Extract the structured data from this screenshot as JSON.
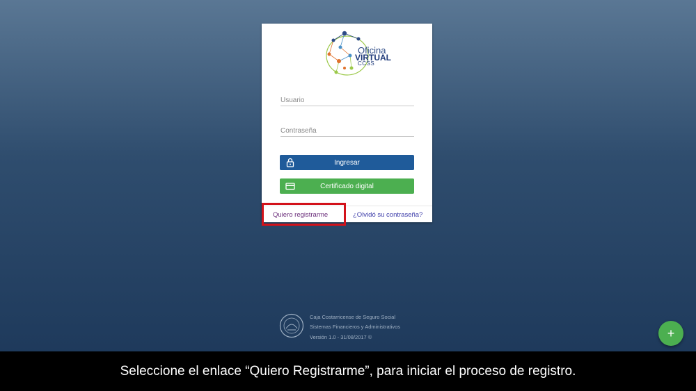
{
  "logo": {
    "line1": "Oficina",
    "line2": "VIRTUAL",
    "line3": "CCSS"
  },
  "login": {
    "user_placeholder": "Usuario",
    "pass_placeholder": "Contraseña",
    "ingresar_label": "Ingresar",
    "cert_label": "Certificado digital",
    "register_link": "Quiero registrarme",
    "forgot_link": "¿Olvidó su contraseña?"
  },
  "footer": {
    "line1": "Caja Costarricense de Seguro Social",
    "line2": "Sistemas Financieros y Administrativos",
    "line3": "Versión 1.0 - 31/08/2017 ©"
  },
  "fab": {
    "label": "+"
  },
  "caption": {
    "text": "Seleccione el enlace “Quiero Registrarme”, para iniciar el proceso de registro."
  },
  "colors": {
    "primary": "#1f5b9a",
    "success": "#4caf50",
    "highlight": "#d3121a"
  },
  "icons": {
    "ingresar": "lock-icon",
    "cert": "card-icon",
    "fab": "plus-icon"
  }
}
